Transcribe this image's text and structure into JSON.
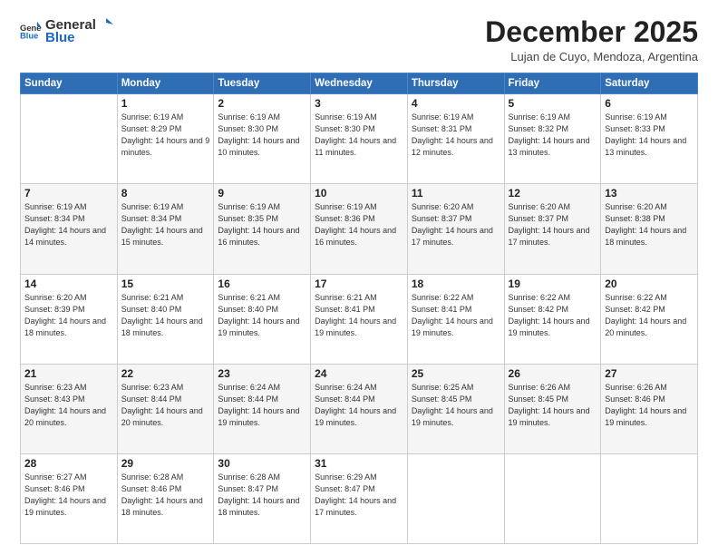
{
  "logo": {
    "text_general": "General",
    "text_blue": "Blue"
  },
  "title": "December 2025",
  "subtitle": "Lujan de Cuyo, Mendoza, Argentina",
  "days_of_week": [
    "Sunday",
    "Monday",
    "Tuesday",
    "Wednesday",
    "Thursday",
    "Friday",
    "Saturday"
  ],
  "weeks": [
    [
      {
        "day": "",
        "sunrise": "",
        "sunset": "",
        "daylight": ""
      },
      {
        "day": "1",
        "sunrise": "Sunrise: 6:19 AM",
        "sunset": "Sunset: 8:29 PM",
        "daylight": "Daylight: 14 hours and 9 minutes."
      },
      {
        "day": "2",
        "sunrise": "Sunrise: 6:19 AM",
        "sunset": "Sunset: 8:30 PM",
        "daylight": "Daylight: 14 hours and 10 minutes."
      },
      {
        "day": "3",
        "sunrise": "Sunrise: 6:19 AM",
        "sunset": "Sunset: 8:30 PM",
        "daylight": "Daylight: 14 hours and 11 minutes."
      },
      {
        "day": "4",
        "sunrise": "Sunrise: 6:19 AM",
        "sunset": "Sunset: 8:31 PM",
        "daylight": "Daylight: 14 hours and 12 minutes."
      },
      {
        "day": "5",
        "sunrise": "Sunrise: 6:19 AM",
        "sunset": "Sunset: 8:32 PM",
        "daylight": "Daylight: 14 hours and 13 minutes."
      },
      {
        "day": "6",
        "sunrise": "Sunrise: 6:19 AM",
        "sunset": "Sunset: 8:33 PM",
        "daylight": "Daylight: 14 hours and 13 minutes."
      }
    ],
    [
      {
        "day": "7",
        "sunrise": "Sunrise: 6:19 AM",
        "sunset": "Sunset: 8:34 PM",
        "daylight": "Daylight: 14 hours and 14 minutes."
      },
      {
        "day": "8",
        "sunrise": "Sunrise: 6:19 AM",
        "sunset": "Sunset: 8:34 PM",
        "daylight": "Daylight: 14 hours and 15 minutes."
      },
      {
        "day": "9",
        "sunrise": "Sunrise: 6:19 AM",
        "sunset": "Sunset: 8:35 PM",
        "daylight": "Daylight: 14 hours and 16 minutes."
      },
      {
        "day": "10",
        "sunrise": "Sunrise: 6:19 AM",
        "sunset": "Sunset: 8:36 PM",
        "daylight": "Daylight: 14 hours and 16 minutes."
      },
      {
        "day": "11",
        "sunrise": "Sunrise: 6:20 AM",
        "sunset": "Sunset: 8:37 PM",
        "daylight": "Daylight: 14 hours and 17 minutes."
      },
      {
        "day": "12",
        "sunrise": "Sunrise: 6:20 AM",
        "sunset": "Sunset: 8:37 PM",
        "daylight": "Daylight: 14 hours and 17 minutes."
      },
      {
        "day": "13",
        "sunrise": "Sunrise: 6:20 AM",
        "sunset": "Sunset: 8:38 PM",
        "daylight": "Daylight: 14 hours and 18 minutes."
      }
    ],
    [
      {
        "day": "14",
        "sunrise": "Sunrise: 6:20 AM",
        "sunset": "Sunset: 8:39 PM",
        "daylight": "Daylight: 14 hours and 18 minutes."
      },
      {
        "day": "15",
        "sunrise": "Sunrise: 6:21 AM",
        "sunset": "Sunset: 8:40 PM",
        "daylight": "Daylight: 14 hours and 18 minutes."
      },
      {
        "day": "16",
        "sunrise": "Sunrise: 6:21 AM",
        "sunset": "Sunset: 8:40 PM",
        "daylight": "Daylight: 14 hours and 19 minutes."
      },
      {
        "day": "17",
        "sunrise": "Sunrise: 6:21 AM",
        "sunset": "Sunset: 8:41 PM",
        "daylight": "Daylight: 14 hours and 19 minutes."
      },
      {
        "day": "18",
        "sunrise": "Sunrise: 6:22 AM",
        "sunset": "Sunset: 8:41 PM",
        "daylight": "Daylight: 14 hours and 19 minutes."
      },
      {
        "day": "19",
        "sunrise": "Sunrise: 6:22 AM",
        "sunset": "Sunset: 8:42 PM",
        "daylight": "Daylight: 14 hours and 19 minutes."
      },
      {
        "day": "20",
        "sunrise": "Sunrise: 6:22 AM",
        "sunset": "Sunset: 8:42 PM",
        "daylight": "Daylight: 14 hours and 20 minutes."
      }
    ],
    [
      {
        "day": "21",
        "sunrise": "Sunrise: 6:23 AM",
        "sunset": "Sunset: 8:43 PM",
        "daylight": "Daylight: 14 hours and 20 minutes."
      },
      {
        "day": "22",
        "sunrise": "Sunrise: 6:23 AM",
        "sunset": "Sunset: 8:44 PM",
        "daylight": "Daylight: 14 hours and 20 minutes."
      },
      {
        "day": "23",
        "sunrise": "Sunrise: 6:24 AM",
        "sunset": "Sunset: 8:44 PM",
        "daylight": "Daylight: 14 hours and 19 minutes."
      },
      {
        "day": "24",
        "sunrise": "Sunrise: 6:24 AM",
        "sunset": "Sunset: 8:44 PM",
        "daylight": "Daylight: 14 hours and 19 minutes."
      },
      {
        "day": "25",
        "sunrise": "Sunrise: 6:25 AM",
        "sunset": "Sunset: 8:45 PM",
        "daylight": "Daylight: 14 hours and 19 minutes."
      },
      {
        "day": "26",
        "sunrise": "Sunrise: 6:26 AM",
        "sunset": "Sunset: 8:45 PM",
        "daylight": "Daylight: 14 hours and 19 minutes."
      },
      {
        "day": "27",
        "sunrise": "Sunrise: 6:26 AM",
        "sunset": "Sunset: 8:46 PM",
        "daylight": "Daylight: 14 hours and 19 minutes."
      }
    ],
    [
      {
        "day": "28",
        "sunrise": "Sunrise: 6:27 AM",
        "sunset": "Sunset: 8:46 PM",
        "daylight": "Daylight: 14 hours and 19 minutes."
      },
      {
        "day": "29",
        "sunrise": "Sunrise: 6:28 AM",
        "sunset": "Sunset: 8:46 PM",
        "daylight": "Daylight: 14 hours and 18 minutes."
      },
      {
        "day": "30",
        "sunrise": "Sunrise: 6:28 AM",
        "sunset": "Sunset: 8:47 PM",
        "daylight": "Daylight: 14 hours and 18 minutes."
      },
      {
        "day": "31",
        "sunrise": "Sunrise: 6:29 AM",
        "sunset": "Sunset: 8:47 PM",
        "daylight": "Daylight: 14 hours and 17 minutes."
      },
      {
        "day": "",
        "sunrise": "",
        "sunset": "",
        "daylight": ""
      },
      {
        "day": "",
        "sunrise": "",
        "sunset": "",
        "daylight": ""
      },
      {
        "day": "",
        "sunrise": "",
        "sunset": "",
        "daylight": ""
      }
    ]
  ]
}
